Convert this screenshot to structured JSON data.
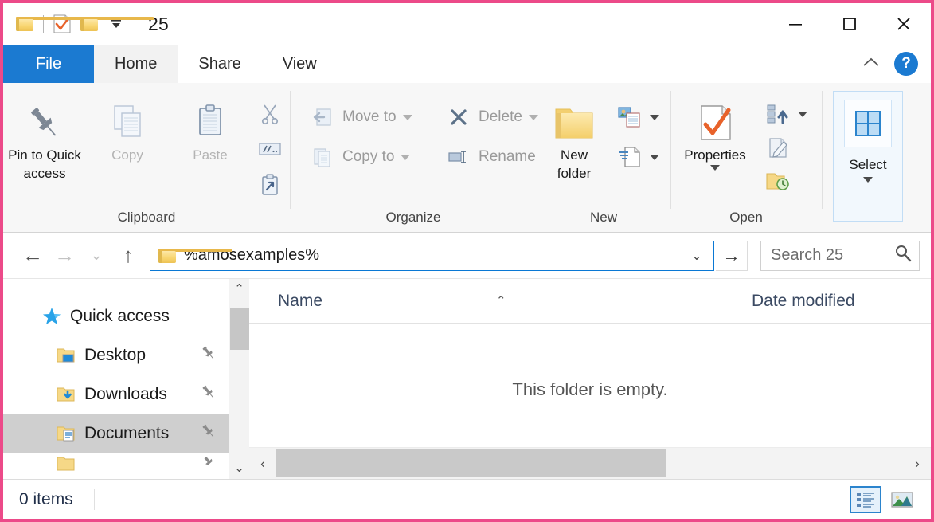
{
  "window": {
    "title": "25",
    "quick_access_toolbar": [
      {
        "name": "folder-icon",
        "label": "Properties folder"
      },
      {
        "name": "properties-checkmark-icon",
        "label": "Properties"
      },
      {
        "name": "new-folder-icon",
        "label": "New folder"
      },
      {
        "name": "customize-dropdown-icon",
        "label": "Customize Quick Access Toolbar"
      }
    ],
    "controls": {
      "minimize": "—",
      "maximize": "□",
      "close": "✕"
    }
  },
  "tabs": [
    {
      "label": "File",
      "state": "file"
    },
    {
      "label": "Home",
      "state": "active"
    },
    {
      "label": "Share",
      "state": "normal"
    },
    {
      "label": "View",
      "state": "normal"
    }
  ],
  "tabrow_right": {
    "collapse_ribbon": "⌃",
    "help": "?"
  },
  "ribbon": {
    "groups": [
      {
        "title": "Clipboard",
        "big_buttons": [
          {
            "label": "Pin to Quick\naccess",
            "label_line1": "Pin to Quick",
            "label_line2": "access",
            "disabled": false,
            "icon": "pin-icon"
          },
          {
            "label": "Copy",
            "disabled": true,
            "icon": "copy-icon"
          },
          {
            "label": "Paste",
            "disabled": true,
            "icon": "paste-icon"
          }
        ],
        "small_buttons": [
          {
            "label": "Cut",
            "icon": "scissors-icon",
            "disabled": true
          },
          {
            "label": "Copy path",
            "icon": "copy-path-icon",
            "disabled": true
          },
          {
            "label": "Paste shortcut",
            "icon": "paste-shortcut-icon",
            "disabled": true
          }
        ]
      },
      {
        "title": "Organize",
        "small_buttons": [
          {
            "label": "Move to",
            "icon": "move-to-icon",
            "disabled": true,
            "has_caret": true
          },
          {
            "label": "Copy to",
            "icon": "copy-to-icon",
            "disabled": true,
            "has_caret": true
          },
          {
            "label": "Delete",
            "icon": "delete-x-icon",
            "disabled": true,
            "has_caret": true
          },
          {
            "label": "Rename",
            "icon": "rename-icon",
            "disabled": true,
            "has_caret": false
          }
        ]
      },
      {
        "title": "New",
        "big_buttons": [
          {
            "label_line1": "New",
            "label_line2": "folder",
            "disabled": false,
            "icon": "new-folder-icon"
          }
        ],
        "small_buttons": [
          {
            "label": "New item",
            "icon": "new-item-icon",
            "disabled": false,
            "has_caret": true
          },
          {
            "label": "Easy access",
            "icon": "easy-access-icon",
            "disabled": false,
            "has_caret": true
          }
        ]
      },
      {
        "title": "Open",
        "big_buttons": [
          {
            "label": "Properties",
            "disabled": false,
            "icon": "properties-checkmark-icon",
            "has_caret": true
          }
        ],
        "small_buttons": [
          {
            "label": "Open",
            "icon": "open-icon",
            "disabled": false,
            "has_caret": true
          },
          {
            "label": "Edit",
            "icon": "edit-pencil-icon",
            "disabled": false,
            "has_caret": false
          },
          {
            "label": "History",
            "icon": "history-icon",
            "disabled": false,
            "has_caret": false
          }
        ]
      }
    ],
    "select_button": {
      "label": "Select",
      "icon": "select-grid-icon",
      "highlighted": true
    }
  },
  "navbar": {
    "back": "←",
    "forward": "→",
    "recent": "⌄",
    "up": "↑",
    "address_value": "%amosexamples%",
    "address_dropdown": "⌄",
    "go": "→",
    "search_placeholder": "Search 25",
    "search_icon": "search-icon"
  },
  "sidebar": {
    "items": [
      {
        "label": "Quick access",
        "icon": "quick-access-star-icon",
        "level": "root",
        "pinned": false,
        "selected": false
      },
      {
        "label": "Desktop",
        "icon": "desktop-folder-icon",
        "level": "child",
        "pinned": true,
        "selected": false
      },
      {
        "label": "Downloads",
        "icon": "downloads-folder-icon",
        "level": "child",
        "pinned": true,
        "selected": false
      },
      {
        "label": "Documents",
        "icon": "documents-folder-icon",
        "level": "child",
        "pinned": true,
        "selected": true
      }
    ],
    "scroll": {
      "up": "⌃",
      "down": "⌄"
    }
  },
  "filelist": {
    "columns": [
      {
        "label": "Name",
        "sorted": "asc",
        "sort_caret": "⌃"
      },
      {
        "label": "Date modified",
        "sorted": "none"
      }
    ],
    "empty_message": "This folder is empty.",
    "hscroll": {
      "left": "‹",
      "right": "›"
    }
  },
  "statusbar": {
    "item_count": "0 items",
    "view_buttons": [
      {
        "name": "details-view",
        "label": "Details view",
        "selected": true
      },
      {
        "name": "large-icons-view",
        "label": "Large icons view",
        "selected": false
      }
    ]
  },
  "colors": {
    "accent": "#1b7ad1",
    "window_border": "#ec4a89",
    "ribbon_bg": "#f7f7f7",
    "selection": "#cfcfcf",
    "folder_yellow": "#f8d46e",
    "checkmark_orange": "#e8622a"
  }
}
